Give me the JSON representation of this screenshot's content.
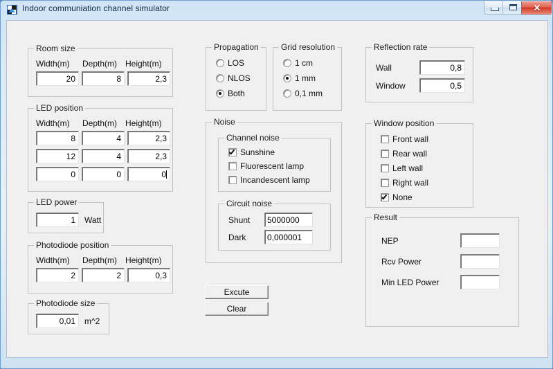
{
  "window": {
    "title": "Indoor communiation channel simulator",
    "icon": "app-icon",
    "buttons": {
      "minimize": "minimize-icon",
      "maximize": "maximize-icon",
      "close": "✕"
    }
  },
  "room_size": {
    "title": "Room size",
    "headers": [
      "Width(m)",
      "Depth(m)",
      "Height(m)"
    ],
    "values": [
      "20",
      "8",
      "2,3"
    ]
  },
  "led_position": {
    "title": "LED position",
    "headers": [
      "Width(m)",
      "Depth(m)",
      "Height(m)"
    ],
    "rows": [
      [
        "8",
        "4",
        "2,3"
      ],
      [
        "12",
        "4",
        "2,3"
      ],
      [
        "0",
        "0",
        "0"
      ]
    ]
  },
  "led_power": {
    "title": "LED power",
    "value": "1",
    "unit": "Watt"
  },
  "photodiode_position": {
    "title": "Photodiode position",
    "headers": [
      "Width(m)",
      "Depth(m)",
      "Height(m)"
    ],
    "values": [
      "2",
      "2",
      "0,3"
    ]
  },
  "photodiode_size": {
    "title": "Photodiode size",
    "value": "0,01",
    "unit": "m^2"
  },
  "propagation": {
    "title": "Propagation",
    "options": [
      "LOS",
      "NLOS",
      "Both"
    ],
    "selected": "Both"
  },
  "grid_resolution": {
    "title": "Grid resolution",
    "options": [
      "1 cm",
      "1 mm",
      "0,1 mm"
    ],
    "selected": "1 mm"
  },
  "noise": {
    "title": "Noise",
    "channel_noise": {
      "title": "Channel noise",
      "options": [
        {
          "label": "Sunshine",
          "checked": true
        },
        {
          "label": "Fluorescent lamp",
          "checked": false
        },
        {
          "label": "Incandescent lamp",
          "checked": false
        }
      ]
    },
    "circuit_noise": {
      "title": "Circuit noise",
      "shunt_label": "Shunt",
      "shunt_value": "5000000",
      "dark_label": "Dark",
      "dark_value": "0,000001"
    }
  },
  "reflection_rate": {
    "title": "Reflection rate",
    "wall_label": "Wall",
    "wall_value": "0,8",
    "window_label": "Window",
    "window_value": "0,5"
  },
  "window_position": {
    "title": "Window position",
    "options": [
      {
        "label": "Front wall",
        "checked": false
      },
      {
        "label": "Rear wall",
        "checked": false
      },
      {
        "label": "Left wall",
        "checked": false
      },
      {
        "label": "Right wall",
        "checked": false
      },
      {
        "label": "None",
        "checked": true
      }
    ]
  },
  "result": {
    "title": "Result",
    "rows": [
      {
        "label": "NEP",
        "value": ""
      },
      {
        "label": "Rcv Power",
        "value": ""
      },
      {
        "label": "Min LED Power",
        "value": ""
      }
    ]
  },
  "actions": {
    "execute": "Excute",
    "clear": "Clear"
  },
  "colors": {
    "frame": "#cfe4f5",
    "client": "#f0f0f0",
    "close_button": "#cf3a28",
    "group_border": "#c2c2c2"
  }
}
